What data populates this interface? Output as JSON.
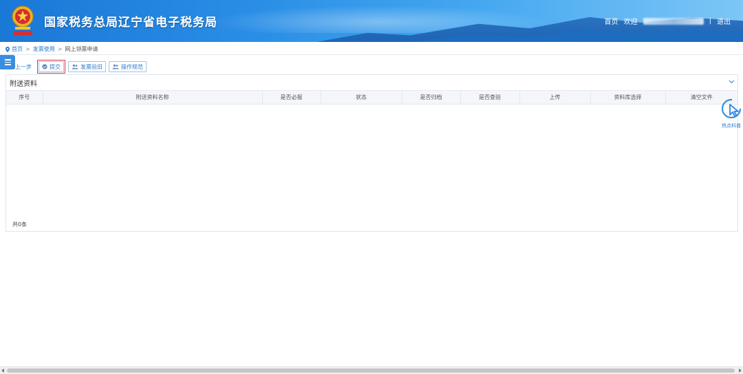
{
  "header": {
    "site_title": "国家税务总局辽宁省电子税务局",
    "emblem_icon": "tax-emblem-icon",
    "nav": {
      "home": "首页",
      "welcome": "欢迎",
      "separator": "|",
      "logout": "退出"
    }
  },
  "breadcrumb": {
    "items": [
      "首页",
      "发票使用",
      "网上领票申请"
    ],
    "separator": ">"
  },
  "toolbar": {
    "prev": "上一步",
    "submit": "提交",
    "invoice_vault": "发票验旧",
    "operation_guide": "操作规范"
  },
  "panel": {
    "title": "附送资料",
    "columns": [
      "序号",
      "附送资料名称",
      "是否必报",
      "状态",
      "是否归档",
      "是否查验",
      "上传",
      "资料库选择",
      "清空文件"
    ],
    "rows": [],
    "footer": "共0条"
  },
  "hot_tool": {
    "label": "热点科普",
    "icon": "cursor-click-icon"
  },
  "colors": {
    "header": "#2a8ee6",
    "accent": "#2a7bd0",
    "highlight": "#e0323a"
  }
}
